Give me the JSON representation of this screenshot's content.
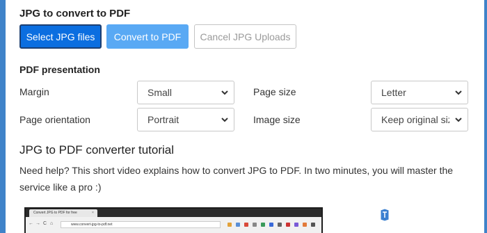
{
  "converter": {
    "heading": "JPG to convert to PDF",
    "select_label": "Select JPG files",
    "convert_label": "Convert to PDF",
    "cancel_label": "Cancel JPG Uploads"
  },
  "presentation": {
    "heading": "PDF presentation",
    "margin_label": "Margin",
    "margin_value": "Small",
    "page_size_label": "Page size",
    "page_size_value": "Letter",
    "orientation_label": "Page orientation",
    "orientation_value": "Portrait",
    "image_size_label": "Image size",
    "image_size_value": "Keep original size"
  },
  "tutorial": {
    "heading": "JPG to PDF converter tutorial",
    "text": "Need help? This short video explains how to convert JPG to PDF. In two minutes, you will master the service like a pro :)"
  },
  "video": {
    "tab_title": "Convert JPG to PDF for free",
    "tab_close": "×",
    "url": "www.convert-jpg-to-pdf.net",
    "nav_back": "←",
    "nav_forward": "→",
    "nav_reload": "C",
    "nav_home": "⌂"
  },
  "watermark": {
    "text": "TheWindowsClub"
  },
  "colors": {
    "page_background": "#3f83c9",
    "primary_button": "#0b6ee0",
    "secondary_button": "#59a9f4"
  }
}
